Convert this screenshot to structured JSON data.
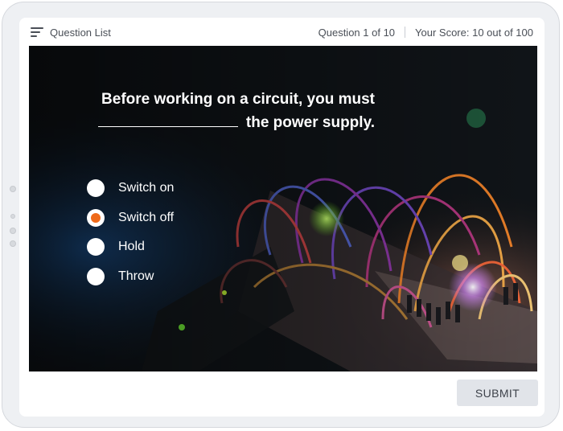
{
  "header": {
    "question_list_label": "Question List",
    "question_progress": "Question 1 of 10",
    "score": "Your Score: 10 out of 100"
  },
  "question": {
    "text_line1": "Before working on a circuit, you must",
    "text_line2": "the power supply."
  },
  "options": [
    {
      "label": "Switch on",
      "selected": false
    },
    {
      "label": "Switch off",
      "selected": true
    },
    {
      "label": "Hold",
      "selected": false
    },
    {
      "label": "Throw",
      "selected": false
    }
  ],
  "footer": {
    "submit_label": "SUBMIT"
  },
  "colors": {
    "accent": "#ef6a1a",
    "submit_bg": "#e1e4e9"
  },
  "icons": {
    "question_list": "list-icon"
  }
}
